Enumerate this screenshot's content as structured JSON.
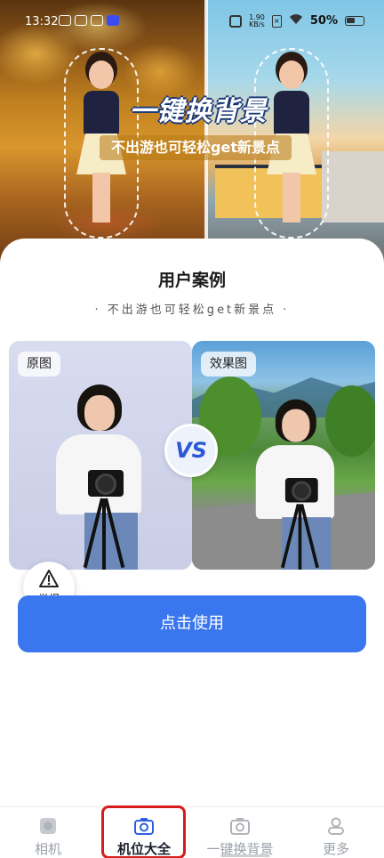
{
  "status_bar": {
    "time": "13:32",
    "network_speed": "1.90\nKB/s",
    "battery": "50%"
  },
  "hero": {
    "title": "一键换背景",
    "subtitle": "不出游也可轻松get新景点"
  },
  "section": {
    "title": "用户案例",
    "subtitle": "· 不出游也可轻松get新景点 ·"
  },
  "comparison": {
    "original_label": "原图",
    "result_label": "效果图",
    "vs_label": "VS"
  },
  "report": {
    "label": "举报"
  },
  "cta": {
    "label": "点击使用"
  },
  "bottom_nav": {
    "items": [
      {
        "label": "相机",
        "icon": "camera-square-icon",
        "active": false
      },
      {
        "label": "机位大全",
        "icon": "camera-icon",
        "active": true
      },
      {
        "label": "一键换背景",
        "icon": "camera-icon",
        "active": false
      },
      {
        "label": "更多",
        "icon": "person-icon",
        "active": false
      }
    ]
  },
  "colors": {
    "accent": "#3a76ee",
    "active_icon": "#2d5fe0",
    "highlight_box": "#d51c1c"
  }
}
